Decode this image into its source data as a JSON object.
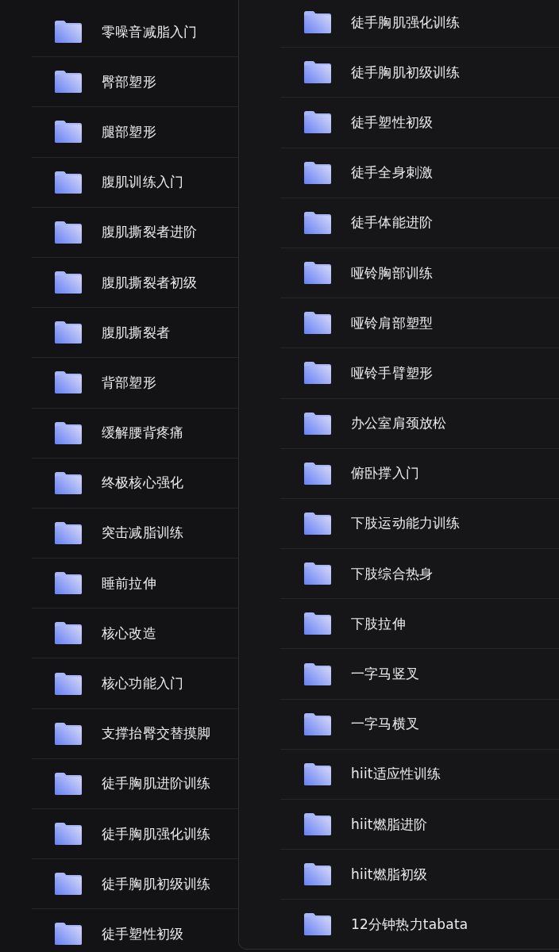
{
  "left_list": {
    "items": [
      {
        "label": "零噪音减脂入门"
      },
      {
        "label": "臀部塑形"
      },
      {
        "label": "腿部塑形"
      },
      {
        "label": "腹肌训练入门"
      },
      {
        "label": "腹肌撕裂者进阶"
      },
      {
        "label": "腹肌撕裂者初级"
      },
      {
        "label": "腹肌撕裂者"
      },
      {
        "label": "背部塑形"
      },
      {
        "label": "缓解腰背疼痛"
      },
      {
        "label": "终极核心强化"
      },
      {
        "label": "突击减脂训练"
      },
      {
        "label": "睡前拉伸"
      },
      {
        "label": "核心改造"
      },
      {
        "label": "核心功能入门"
      },
      {
        "label": "支撑抬臀交替摸脚"
      },
      {
        "label": "徒手胸肌进阶训练"
      },
      {
        "label": "徒手胸肌强化训练"
      },
      {
        "label": "徒手胸肌初级训练"
      },
      {
        "label": "徒手塑性初级"
      }
    ]
  },
  "right_panel": {
    "items": [
      {
        "label": "徒手胸肌强化训练"
      },
      {
        "label": "徒手胸肌初级训练"
      },
      {
        "label": "徒手塑性初级"
      },
      {
        "label": "徒手全身刺激"
      },
      {
        "label": "徒手体能进阶"
      },
      {
        "label": "哑铃胸部训练"
      },
      {
        "label": "哑铃肩部塑型"
      },
      {
        "label": "哑铃手臂塑形"
      },
      {
        "label": "办公室肩颈放松"
      },
      {
        "label": "俯卧撑入门"
      },
      {
        "label": "下肢运动能力训练"
      },
      {
        "label": "下肢综合热身"
      },
      {
        "label": "下肢拉伸"
      },
      {
        "label": "一字马竖叉"
      },
      {
        "label": "一字马横叉"
      },
      {
        "label": "hiit适应性训练"
      },
      {
        "label": "hiit燃脂进阶"
      },
      {
        "label": "hiit燃脂初级"
      },
      {
        "label": "12分钟热力tabata"
      }
    ]
  }
}
